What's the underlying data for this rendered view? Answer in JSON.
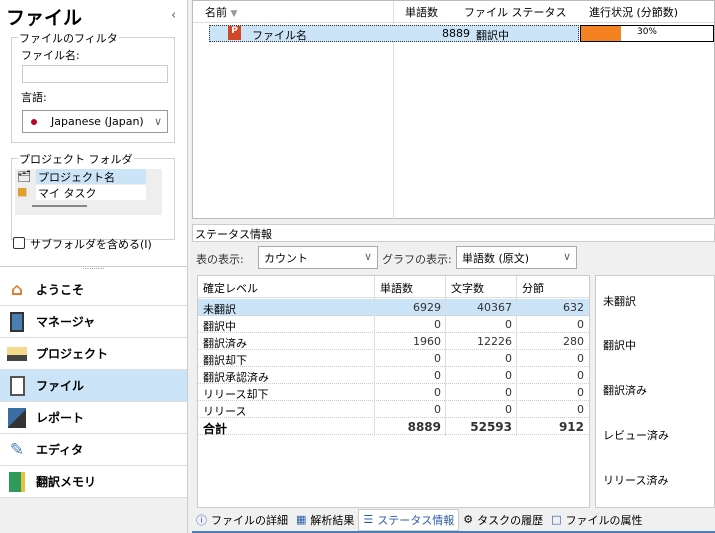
{
  "sidebar": {
    "title": "ファイル",
    "collapse_icon": "chevron-left-icon",
    "filter": {
      "group_label": "ファイルのフィルタ",
      "file_name_label": "ファイル名:",
      "file_name_value": "",
      "language_label": "言語:",
      "language_value": "Japanese (Japan)"
    },
    "project_folder": {
      "group_label": "プロジェクト フォルダ",
      "items": [
        "プロジェクト名",
        "マイ タスク"
      ]
    },
    "include_subfolders": {
      "label": "サブフォルダを含める(I)",
      "checked": false
    },
    "nav": [
      {
        "label": "ようこそ",
        "icon": "home-icon"
      },
      {
        "label": "マネージャ",
        "icon": "manager-icon"
      },
      {
        "label": "プロジェクト",
        "icon": "folder-icon"
      },
      {
        "label": "ファイル",
        "icon": "file-icon",
        "selected": true
      },
      {
        "label": "レポート",
        "icon": "report-icon"
      },
      {
        "label": "エディタ",
        "icon": "pencil-icon"
      },
      {
        "label": "翻訳メモリ",
        "icon": "translation-memory-icon"
      }
    ]
  },
  "file_list": {
    "columns": [
      "名前",
      "単語数",
      "ファイル ステータス",
      "進行状況 (分節数)"
    ],
    "rows": [
      {
        "name": "ファイル名",
        "words": "8889",
        "status": "翻訳中",
        "progress_label": "30%",
        "progress": 30
      }
    ]
  },
  "status": {
    "title": "ステータス情報",
    "table_view_label": "表の表示:",
    "table_view_value": "カウント",
    "graph_view_label": "グラフの表示:",
    "graph_view_value": "単語数 (原文)",
    "columns": [
      "確定レベル",
      "単語数",
      "文字数",
      "分節"
    ],
    "rows": [
      [
        "未翻訳",
        "6929",
        "40367",
        "632"
      ],
      [
        "翻訳中",
        "0",
        "0",
        "0"
      ],
      [
        "翻訳済み",
        "1960",
        "12226",
        "280"
      ],
      [
        "翻訳却下",
        "0",
        "0",
        "0"
      ],
      [
        "翻訳承認済み",
        "0",
        "0",
        "0"
      ],
      [
        "リリース却下",
        "0",
        "0",
        "0"
      ],
      [
        "リリース",
        "0",
        "0",
        "0"
      ]
    ],
    "total": [
      "合計",
      "8889",
      "52593",
      "912"
    ],
    "chart_labels": [
      "未翻訳",
      "翻訳中",
      "翻訳済み",
      "レビュー済み",
      "リリース済み"
    ]
  },
  "tabs": [
    {
      "label": "ファイルの詳細"
    },
    {
      "label": "解析結果"
    },
    {
      "label": "ステータス情報",
      "active": true
    },
    {
      "label": "タスクの履歴"
    },
    {
      "label": "ファイルの属性"
    }
  ],
  "colors": {
    "selection": "#cce4f7",
    "progress": "#f58220"
  }
}
